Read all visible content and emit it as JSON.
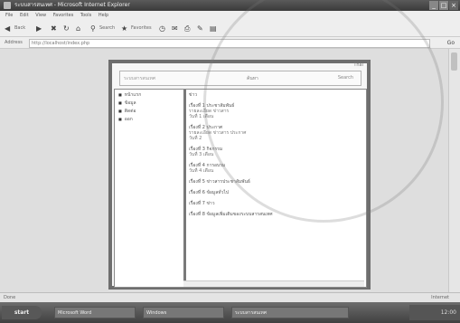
{
  "window": {
    "title": "ระบบสารสนเทศ - Microsoft Internet Explorer",
    "controls": [
      "_",
      "□",
      "×"
    ]
  },
  "menu": [
    "File",
    "Edit",
    "View",
    "Favorites",
    "Tools",
    "Help"
  ],
  "toolbar": {
    "back": "Back",
    "search_label": "Search",
    "favorites_label": "Favorites"
  },
  "address": {
    "label": "Address",
    "url": "http://localhost/index.php",
    "go": "Go"
  },
  "page": {
    "header_left": "ระบบสารสนเทศ",
    "header_label": "ค้นหา",
    "header_right": "Search",
    "tag": "Thai",
    "nav": [
      "หน้าแรก",
      "ข้อมูล",
      "ติดต่อ",
      "ออก"
    ],
    "main_title": "ข่าว",
    "items": [
      {
        "title": "เรื่องที่ 1 ประชาสัมพันธ์",
        "line2": "รายละเอียด ข่าวสาร",
        "line3": "วันที่ 1 เดือน"
      },
      {
        "title": "เรื่องที่ 2 ประกาศ",
        "line2": "รายละเอียด ข่าวสาร ประกาศ",
        "line3": "วันที่ 2"
      },
      {
        "title": "เรื่องที่ 3 กิจกรรม",
        "line2": "วันที่ 3 เดือน",
        "line3": ""
      },
      {
        "title": "เรื่องที่ 4 การอบรม",
        "line2": "วันที่ 4 เดือน",
        "line3": ""
      },
      {
        "title": "เรื่องที่ 5 ข่าวสารประชาสัมพันธ์",
        "line2": "",
        "line3": ""
      },
      {
        "title": "เรื่องที่ 6 ข้อมูลทั่วไป",
        "line2": "",
        "line3": ""
      },
      {
        "title": "เรื่องที่ 7 ข่าว",
        "line2": "",
        "line3": ""
      },
      {
        "title": "เรื่องที่ 8 ข้อมูลเพิ่มเติมของระบบสารสนเทศ",
        "line2": "",
        "line3": ""
      }
    ]
  },
  "status": {
    "left": "Done",
    "right": "Internet"
  },
  "taskbar": {
    "start": "start",
    "buttons": [
      "Microsoft Word",
      "Windows",
      "ระบบสารสนเทศ"
    ],
    "tray": "12:00"
  }
}
